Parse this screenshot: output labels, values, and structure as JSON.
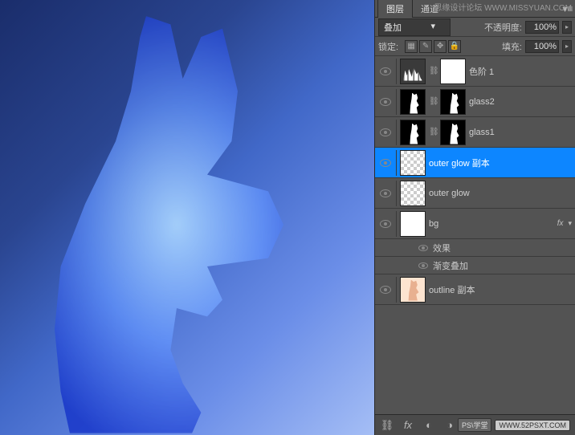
{
  "watermarks": {
    "top_right": "思缘设计论坛  WWW.MISSYUAN.COM",
    "badge1": "PS\\学堂",
    "badge2": "WWW.52PSXT.COM"
  },
  "tabs": {
    "layers": "图层",
    "channels": "通道"
  },
  "blend_row": {
    "mode": "叠加",
    "opacity_label": "不透明度:",
    "opacity": "100%"
  },
  "lock_row": {
    "lock_label": "锁定:",
    "fill_label": "填充:",
    "fill": "100%"
  },
  "layers": [
    {
      "name": "色阶 1",
      "type": "adjustment"
    },
    {
      "name": "glass2",
      "type": "masked"
    },
    {
      "name": "glass1",
      "type": "masked"
    },
    {
      "name": "outer glow 副本",
      "type": "normal",
      "selected": true
    },
    {
      "name": "outer glow",
      "type": "normal"
    },
    {
      "name": "bg",
      "type": "white",
      "fx": true
    },
    {
      "name": "outline 副本",
      "type": "skin"
    }
  ],
  "fx_sub": {
    "effects": "效果",
    "gradient_overlay": "渐变叠加"
  }
}
